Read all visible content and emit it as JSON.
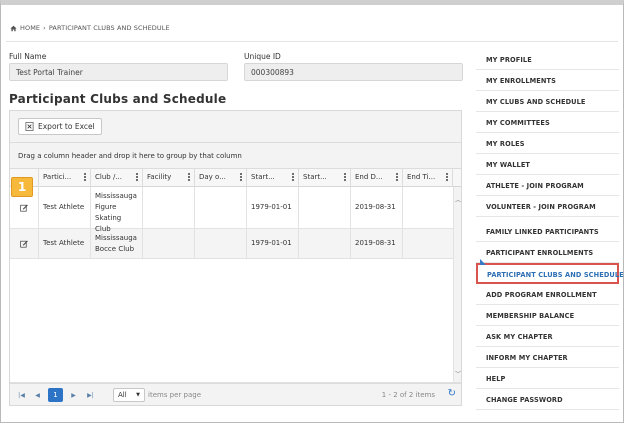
{
  "breadcrumb": {
    "home": "HOME",
    "separator": "›",
    "current": "PARTICIPANT CLUBS AND SCHEDULE"
  },
  "profile": {
    "full_name_label": "Full Name",
    "full_name_value": "Test Portal Trainer",
    "unique_id_label": "Unique ID",
    "unique_id_value": "000300893"
  },
  "page_title": "Participant Clubs and Schedule",
  "grid": {
    "export_label": "Export to Excel",
    "group_hint": "Drag a column header and drop it here to group by that column",
    "columns": [
      "Partici...",
      "Club /...",
      "Facility",
      "Day o...",
      "Start...",
      "Start...",
      "End D...",
      "End Ti..."
    ],
    "rows": [
      {
        "participant": "Test Athlete",
        "club": [
          "Mississauga",
          "Figure",
          "Skating Club"
        ],
        "facility": "",
        "day": "",
        "start_date": "1979-01-01",
        "start_time": "",
        "end_date": "2019-08-31",
        "end_time": ""
      },
      {
        "participant": "Test Athlete",
        "club": [
          "Mississauga",
          "Bocce Club"
        ],
        "facility": "",
        "day": "",
        "start_date": "1979-01-01",
        "start_time": "",
        "end_date": "2019-08-31",
        "end_time": ""
      }
    ],
    "pager": {
      "current_page": "1",
      "page_size": "All",
      "items_per_page": "items per page",
      "info": "1 - 2 of 2 items"
    }
  },
  "callout_number": "1",
  "sidebar": {
    "items": [
      "MY PROFILE",
      "MY ENROLLMENTS",
      "MY CLUBS AND SCHEDULE",
      "MY COMMITTEES",
      "MY ROLES",
      "MY WALLET",
      "ATHLETE - JOIN PROGRAM",
      "VOLUNTEER - JOIN PROGRAM"
    ],
    "items2": [
      "FAMILY LINKED PARTICIPANTS",
      "PARTICIPANT ENROLLMENTS",
      "PARTICIPANT CLUBS AND SCHEDULE",
      "ADD PROGRAM ENROLLMENT",
      "MEMBERSHIP BALANCE",
      "ASK MY CHAPTER",
      "INFORM MY CHAPTER",
      "HELP",
      "CHANGE PASSWORD"
    ],
    "active_index": 2
  },
  "colors": {
    "accent": "#2d74c7",
    "highlight_border": "#d9534f",
    "callout": "#f6b93b"
  }
}
